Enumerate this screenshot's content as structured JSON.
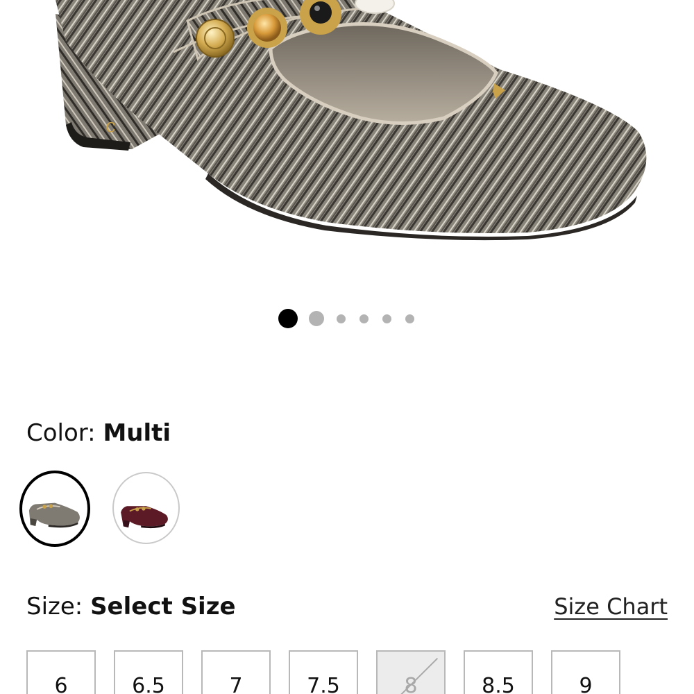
{
  "product": {
    "image_alt": "Herringbone tweed Mary Jane block-heel shoe with jeweled straps"
  },
  "gallery": {
    "total_images": 6,
    "active_index": 0
  },
  "color": {
    "label": "Color:",
    "value": "Multi",
    "swatches": [
      {
        "name": "Multi",
        "selected": true,
        "shoe_color": "#7f7a72"
      },
      {
        "name": "Burgundy",
        "selected": false,
        "shoe_color": "#5c1a26"
      }
    ]
  },
  "size": {
    "label": "Size:",
    "value": "Select Size",
    "chart_link": "Size Chart",
    "options": [
      {
        "label": "6",
        "available": true
      },
      {
        "label": "6.5",
        "available": true
      },
      {
        "label": "7",
        "available": true
      },
      {
        "label": "7.5",
        "available": true
      },
      {
        "label": "8",
        "available": false
      },
      {
        "label": "8.5",
        "available": true
      },
      {
        "label": "9",
        "available": true
      }
    ]
  },
  "colors": {
    "active_dot": "#000000",
    "inactive_dot": "#b3b3b3",
    "tweed_base": "#7b766d",
    "tweed_dark": "#3b3833",
    "gold": "#c9a24a",
    "lining": "#8d8477"
  }
}
